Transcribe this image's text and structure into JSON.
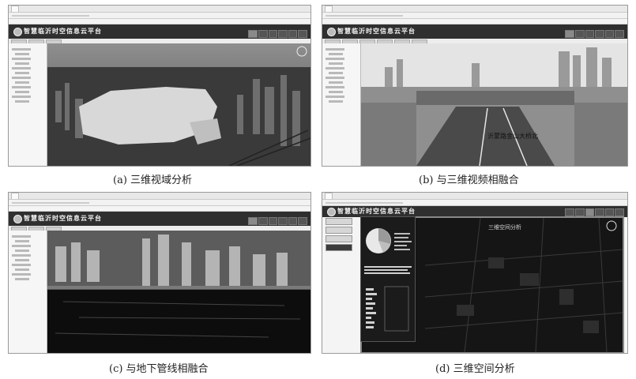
{
  "captions": {
    "a": "(a) 三维视域分析",
    "b": "(b) 与三维视频相融合",
    "c": "(c) 与地下管线相融合",
    "d": "(d) 三维空间分析"
  },
  "app": {
    "title": "智慧临沂时空信息云平台"
  },
  "video_overlay_label": "沂蒙路金山大桥北",
  "space_analysis_title": "三维空间分析",
  "colors": {
    "header_bg": "#2f2f2f",
    "sky": "#cfcfcf",
    "viewshed": "#d8d8d8",
    "dark_bg": "#141414"
  }
}
